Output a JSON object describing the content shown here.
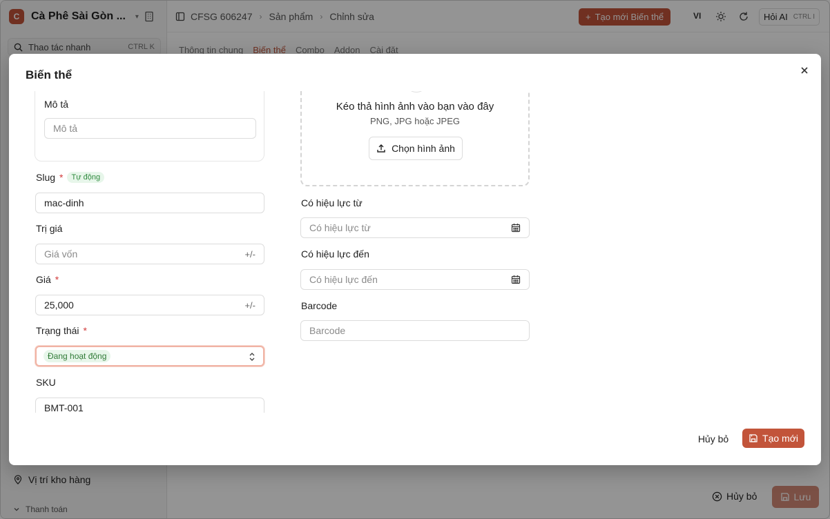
{
  "sidebar": {
    "brand_initial": "C",
    "brand_name": "Cà Phê Sài Gòn ...",
    "quick_action_label": "Thao tác nhanh",
    "quick_action_shortcut": "CTRL K",
    "item_inventory_location": "Vị trí kho hàng",
    "group_payment": "Thanh toán"
  },
  "topbar": {
    "breadcrumb": [
      "CFSG 606247",
      "Sản phẩm",
      "Chỉnh sửa"
    ],
    "create_variant_label": "Tạo mới Biến thể",
    "language": "VI",
    "ask_ai_label": "Hỏi AI",
    "ask_ai_shortcut": "CTRL I"
  },
  "page_tabs": [
    "Thông tin chung",
    "Biến thể",
    "Combo",
    "Addon",
    "Cài đặt"
  ],
  "page_footer": {
    "cancel_label": "Hủy bỏ",
    "save_label": "Lưu"
  },
  "modal": {
    "title": "Biến thể",
    "description_label": "Mô tả",
    "description_placeholder": "Mô tả",
    "slug_label": "Slug",
    "slug_auto_badge": "Tự động",
    "slug_value": "mac-dinh",
    "cost_label": "Trị giá",
    "cost_placeholder": "Giá vốn",
    "cost_suffix": "+/-",
    "price_label": "Giá",
    "price_value": "25,000",
    "price_suffix": "+/-",
    "status_label": "Trạng thái",
    "status_value": "Đang hoạt động",
    "sku_label": "SKU",
    "sku_value": "BMT-001",
    "dropzone_title": "Kéo thả hình ảnh vào bạn vào đây",
    "dropzone_subtitle": "PNG, JPG hoặc JPEG",
    "choose_image_label": "Chọn hình ảnh",
    "valid_from_label": "Có hiệu lực từ",
    "valid_from_placeholder": "Có hiệu lực từ",
    "valid_to_label": "Có hiệu lực đến",
    "valid_to_placeholder": "Có hiệu lực đến",
    "barcode_label": "Barcode",
    "barcode_placeholder": "Barcode",
    "required_mark": "*",
    "cancel_label": "Hủy bỏ",
    "create_label": "Tạo mới"
  },
  "colors": {
    "accent": "#c2543a",
    "required": "#d23b3b",
    "status_green": "#2f7a36"
  }
}
